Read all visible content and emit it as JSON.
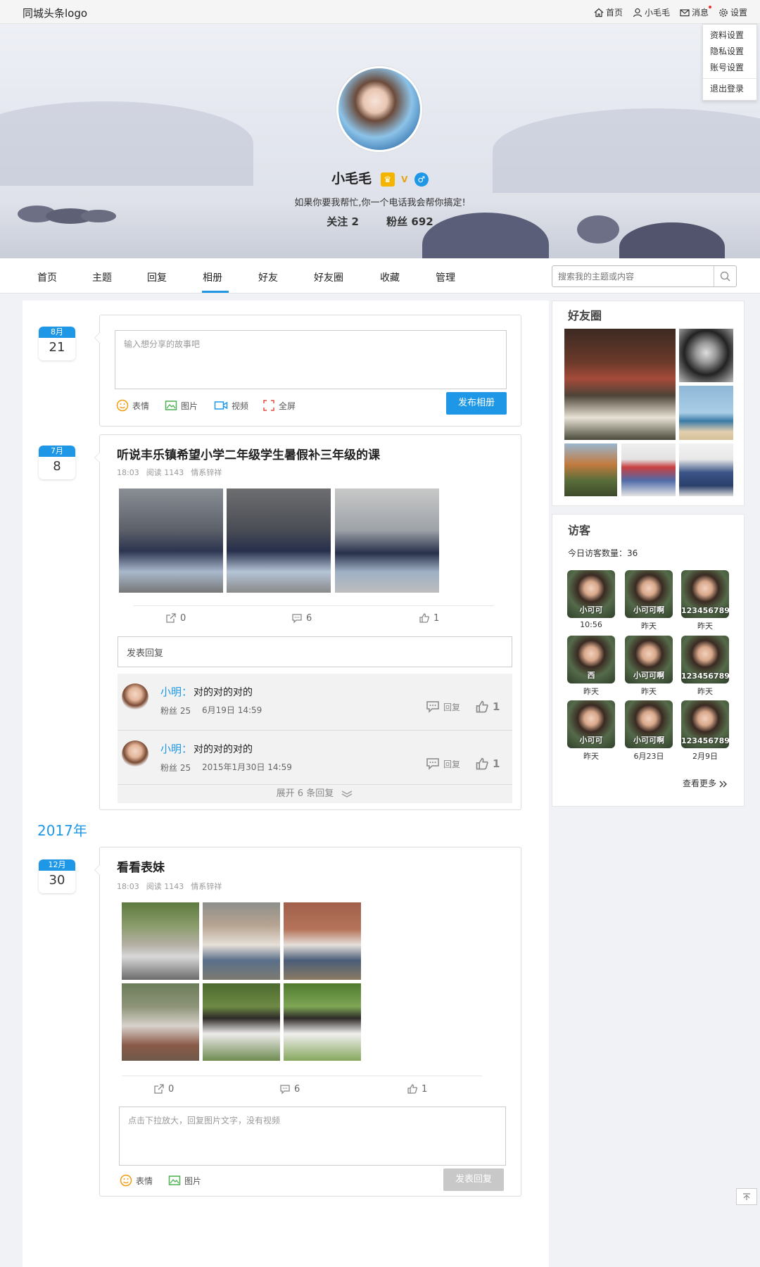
{
  "topbar": {
    "logo": "同城头条logo",
    "home": "首页",
    "user": "小毛毛",
    "messages": "消息",
    "settings": "设置"
  },
  "settings_menu": [
    "资料设置",
    "隐私设置",
    "账号设置",
    "退出登录"
  ],
  "profile": {
    "name": "小毛毛",
    "bio": "如果你要我帮忙,你一个电话我会帮你搞定!",
    "following": "关注 2",
    "fans": "粉丝 692"
  },
  "nav": {
    "tabs": [
      "首页",
      "主题",
      "回复",
      "相册",
      "好友",
      "好友圈",
      "收藏",
      "管理"
    ],
    "active": "相册",
    "search_placeholder": "搜索我的主题或内容"
  },
  "composer": {
    "month": "8月",
    "day": "21",
    "placeholder": "输入想分享的故事吧",
    "emoji": "表情",
    "image": "图片",
    "video": "视频",
    "fullscreen": "全屏",
    "submit": "发布相册"
  },
  "post1": {
    "month": "7月",
    "day": "8",
    "title": "听说丰乐镇希望小学二年级学生暑假补三年级的课",
    "time": "18:03",
    "reads": "阅读 1143",
    "tag": "情系锌祥",
    "shares": "0",
    "comments": "6",
    "likes": "1",
    "reply_placeholder": "发表回复",
    "comment_list": [
      {
        "name": "小明：",
        "text": "对的对的对的",
        "fans": "粉丝 25",
        "time": "6月19日 14:59",
        "reply": "回复",
        "likes": "1"
      },
      {
        "name": "小明：",
        "text": "对的对的对的",
        "fans": "粉丝 25",
        "time": "2015年1月30日 14:59",
        "reply": "回复",
        "likes": "1"
      }
    ],
    "expand": "展开 6 条回复"
  },
  "year_label": "2017年",
  "post2": {
    "month": "12月",
    "day": "30",
    "title": "看看表妹",
    "time": "18:03",
    "reads": "阅读 1143",
    "tag": "情系锌祥",
    "shares": "0",
    "comments": "6",
    "likes": "1",
    "reply_placeholder": "点击下拉放大，回复图片文字，没有视频",
    "emoji": "表情",
    "image": "图片",
    "submit": "发表回复"
  },
  "sidebar": {
    "friends_title": "好友圈",
    "visitors_title": "访客",
    "today_count": "今日访客数量：36",
    "visitors": [
      {
        "name": "小可可",
        "time": "10:56"
      },
      {
        "name": "小可可啊",
        "time": "昨天"
      },
      {
        "name": "123456789",
        "time": "昨天"
      },
      {
        "name": "西",
        "time": "昨天"
      },
      {
        "name": "小可可啊",
        "time": "昨天"
      },
      {
        "name": "123456789",
        "time": "昨天"
      },
      {
        "name": "小可可",
        "time": "昨天"
      },
      {
        "name": "小可可啊",
        "time": "6月23日"
      },
      {
        "name": "123456789",
        "time": "2月9日"
      }
    ],
    "see_more": "查看更多"
  },
  "colors": {
    "accent": "#1e98e6",
    "button_disabled": "#c8c8c8"
  }
}
